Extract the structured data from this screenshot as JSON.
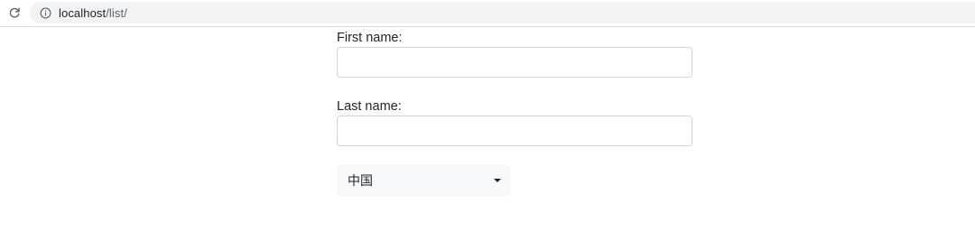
{
  "browser": {
    "url_host": "localhost",
    "url_path": "/list/"
  },
  "form": {
    "first_name_label": "First name:",
    "first_name_value": "",
    "last_name_label": "Last name:",
    "last_name_value": "",
    "country_selected": "中国"
  },
  "icons": {
    "reload": "reload-icon",
    "info": "info-icon",
    "dropdown": "chevron-down-icon"
  }
}
